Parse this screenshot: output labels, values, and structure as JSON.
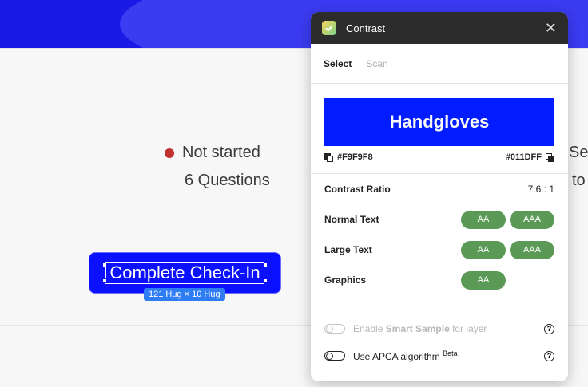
{
  "background": {
    "status": "Not started",
    "questions": "6 Questions",
    "right_line1": "Ser",
    "right_line2": "to",
    "button_label": "Complete Check-In",
    "size_badge": "121 Hug × 10 Hug",
    "colors": {
      "header": "#1a1ae6",
      "button": "#0b10ff",
      "status_dot": "#c0322d"
    }
  },
  "panel": {
    "title": "Contrast",
    "tabs": [
      {
        "label": "Select",
        "active": true
      },
      {
        "label": "Scan",
        "active": false
      }
    ],
    "preview_text": "Handgloves",
    "foreground_hex": "#F9F9F8",
    "background_hex": "#011DFF",
    "contrast": {
      "label": "Contrast Ratio",
      "value": "7.6 : 1"
    },
    "rows": [
      {
        "label": "Normal Text",
        "badges": [
          "AA",
          "AAA"
        ]
      },
      {
        "label": "Large Text",
        "badges": [
          "AA",
          "AAA"
        ]
      },
      {
        "label": "Graphics",
        "badges": [
          "AA"
        ]
      }
    ],
    "smart_sample": {
      "prefix": "Enable ",
      "bold": "Smart Sample",
      "suffix": " for layer"
    },
    "apca": {
      "label": "Use APCA algorithm ",
      "sup": "Beta"
    },
    "help_glyph": "?",
    "close_glyph": "✕",
    "colors": {
      "badge": "#5a9a56",
      "preview_bg": "#011DFF",
      "preview_fg": "#F9F9F8"
    }
  }
}
